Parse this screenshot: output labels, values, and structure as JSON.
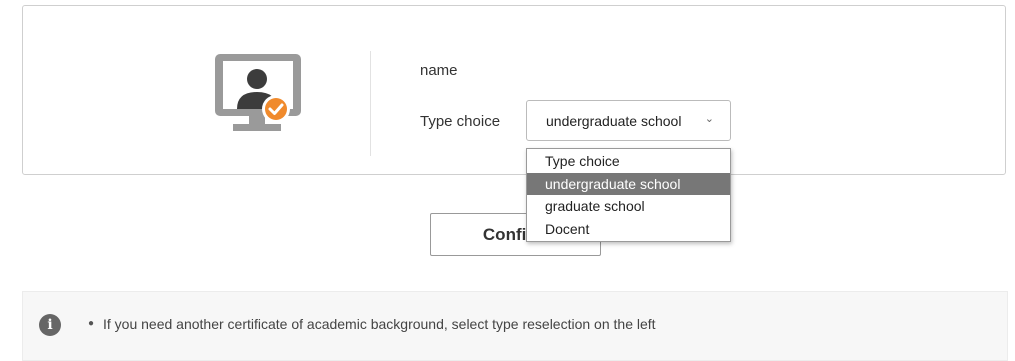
{
  "profile": {
    "name_label": "name",
    "type_label": "Type choice",
    "selected_type": "undergraduate school"
  },
  "dropdown": {
    "options": [
      "Type choice",
      "undergraduate school",
      "graduate school",
      "Docent"
    ],
    "highlighted": "undergraduate school"
  },
  "actions": {
    "confirm_label": "Confirm"
  },
  "notice": {
    "text": "If you need another certificate of academic background, select type reselection on the left"
  },
  "colors": {
    "icon_gray": "#9a9a9a",
    "check_badge": "#f08a2c",
    "highlight": "#777777"
  },
  "icons": {
    "user_monitor": "user-monitor-check-icon",
    "info": "info-icon",
    "chevron": "chevron-down-icon"
  }
}
